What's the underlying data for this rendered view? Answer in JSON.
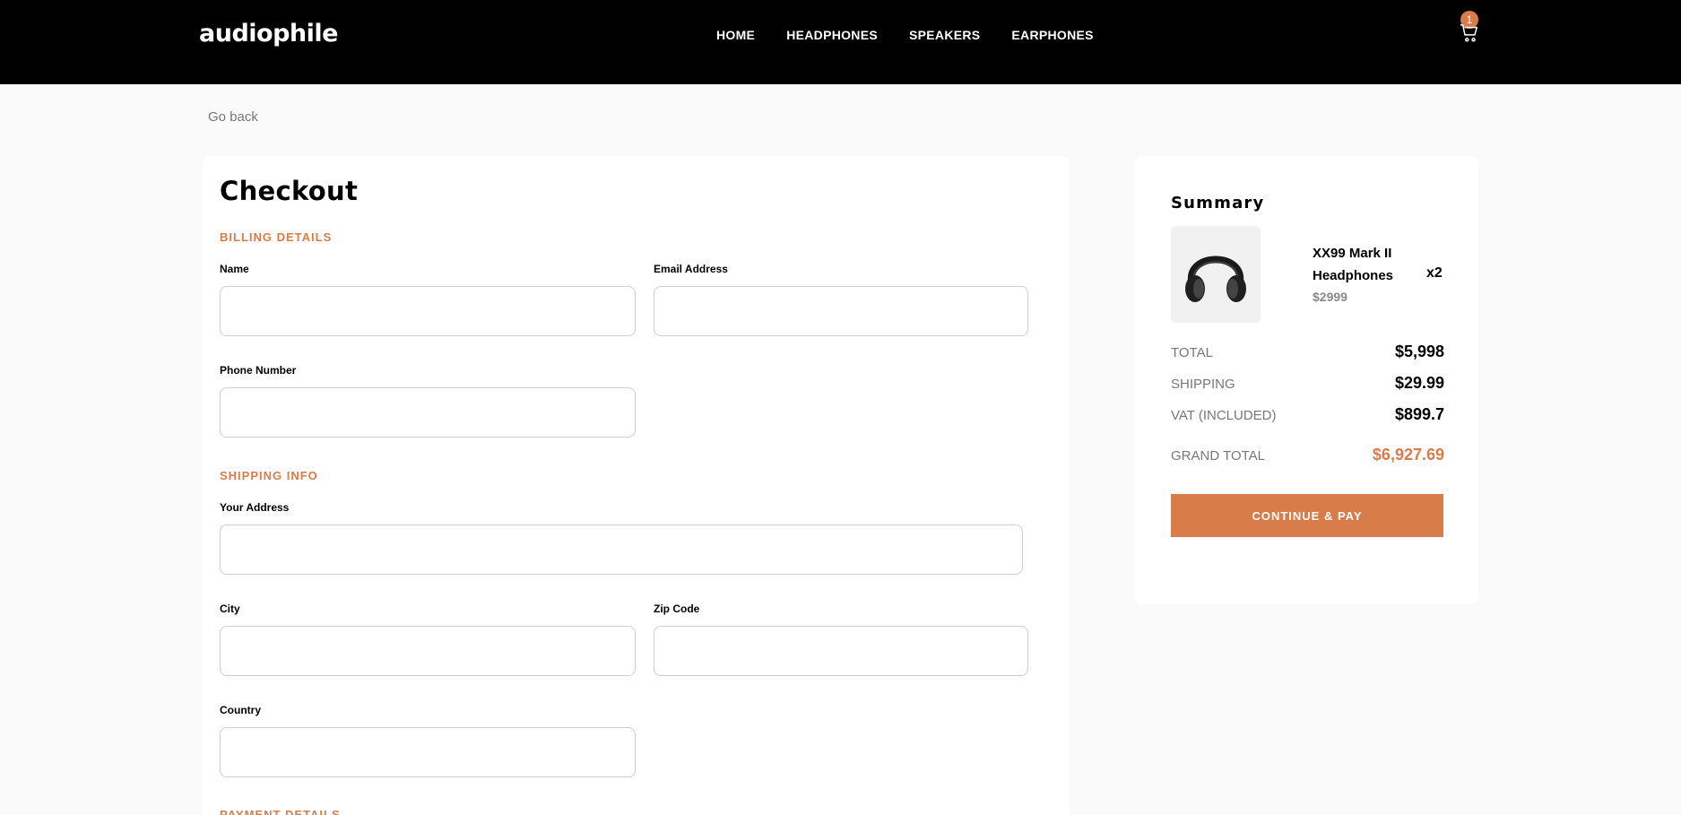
{
  "header": {
    "logo": "audiophile",
    "nav": [
      "HOME",
      "HEADPHONES",
      "SPEAKERS",
      "EARPHONES"
    ],
    "cart_count": "1",
    "cart_icon": "cart-icon"
  },
  "go_back": "Go back",
  "checkout": {
    "title": "Checkout",
    "billing_title": "BILLING DETAILS",
    "name_label": "Name",
    "email_label": "Email Address",
    "phone_label": "Phone Number",
    "shipping_title": "SHIPPING INFO",
    "address_label": "Your Address",
    "city_label": "City",
    "zip_label": "Zip Code",
    "country_label": "Country",
    "payment_title": "PAYMENT DETAILS",
    "values": {
      "name": "",
      "email": "",
      "phone": "",
      "address": "",
      "city": "",
      "zip": "",
      "country": ""
    }
  },
  "summary": {
    "title": "Summary",
    "item": {
      "name": "XX99 Mark II Headphones",
      "price": "$2999",
      "qty": "x2",
      "image_icon": "headphones-icon"
    },
    "total_label": "TOTAL",
    "total_value": "$5,998",
    "shipping_label": "SHIPPING",
    "shipping_value": "$29.99",
    "vat_label": "VAT (INCLUDED)",
    "vat_value": "$899.7",
    "grand_label": "GRAND TOTAL",
    "grand_value": "$6,927.69",
    "pay_button": "CONTINUE & PAY"
  },
  "colors": {
    "accent": "#d87d4a",
    "header_bg": "#000000",
    "page_bg": "#fafafa"
  }
}
